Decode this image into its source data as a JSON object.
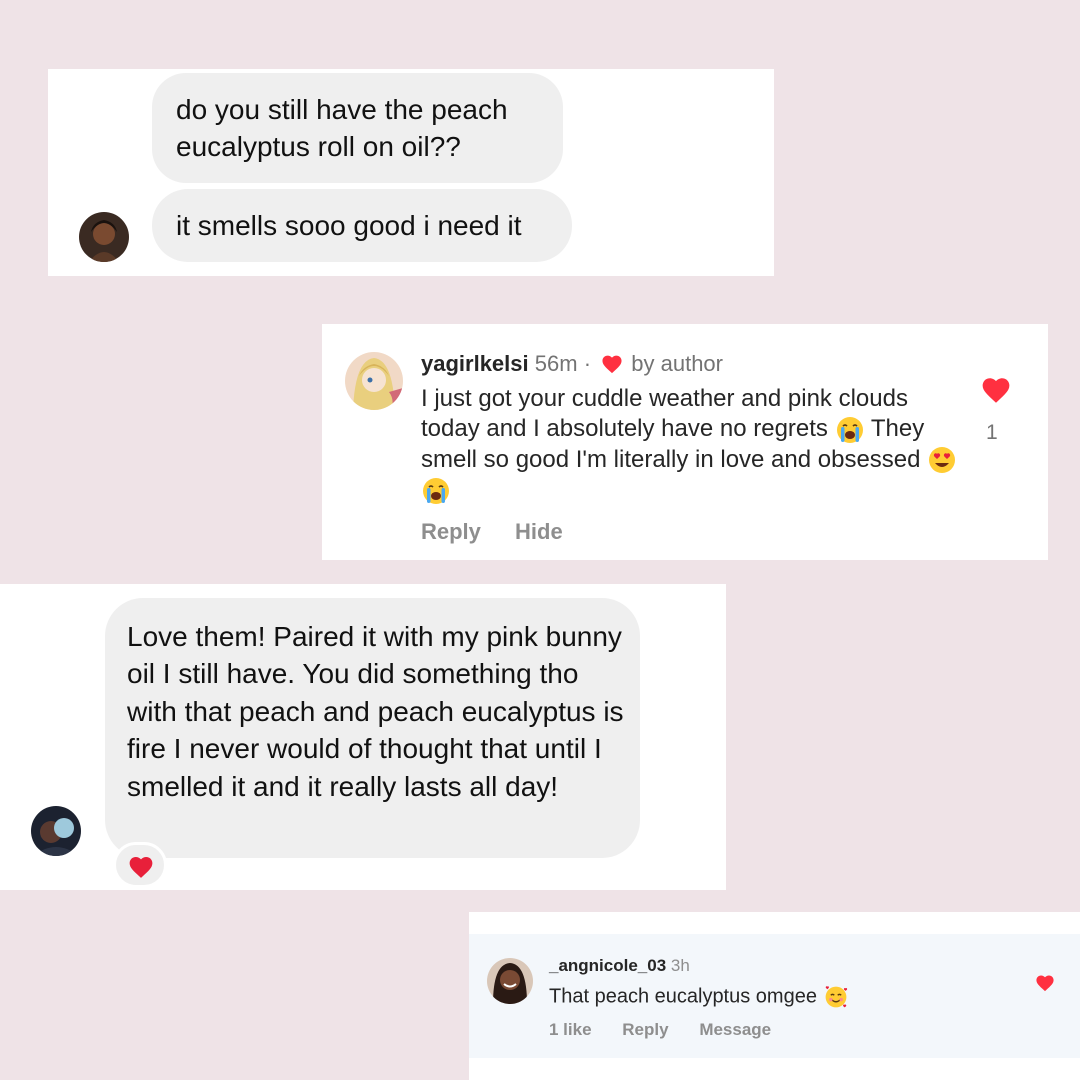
{
  "dm_thread_1": {
    "messages": [
      "do you still have the peach eucalyptus roll on oil??",
      "it smells sooo good i need it"
    ]
  },
  "comment_1": {
    "username": "yagirlkelsi",
    "time": "56m",
    "separator": "·",
    "by_author": "by author",
    "text_parts": [
      "I just got your cuddle weather and pink clouds today and I absolutely have no regrets",
      "They smell so good I'm literally in love and obsessed"
    ],
    "emojis": [
      "loudly-crying-face",
      "heart-eyes-face",
      "loudly-crying-face"
    ],
    "like_count": "1",
    "actions": [
      "Reply",
      "Hide"
    ],
    "accent": "#ff3040"
  },
  "dm_thread_2": {
    "message": "Love them! Paired it with my pink bunny oil I still have. You did something tho with that peach and peach eucalyptus is fire I never would of thought that until I smelled it and it really lasts all day!",
    "reaction": "red-heart"
  },
  "comment_2": {
    "username": "_angnicole_03",
    "time": "3h",
    "text": "That peach eucalyptus omgee",
    "emoji": "smiling-face-with-hearts",
    "actions": [
      "1 like",
      "Reply",
      "Message"
    ]
  },
  "colors": {
    "background": "#efe3e7",
    "bubble": "#efefef",
    "heart": "#ff3040"
  }
}
